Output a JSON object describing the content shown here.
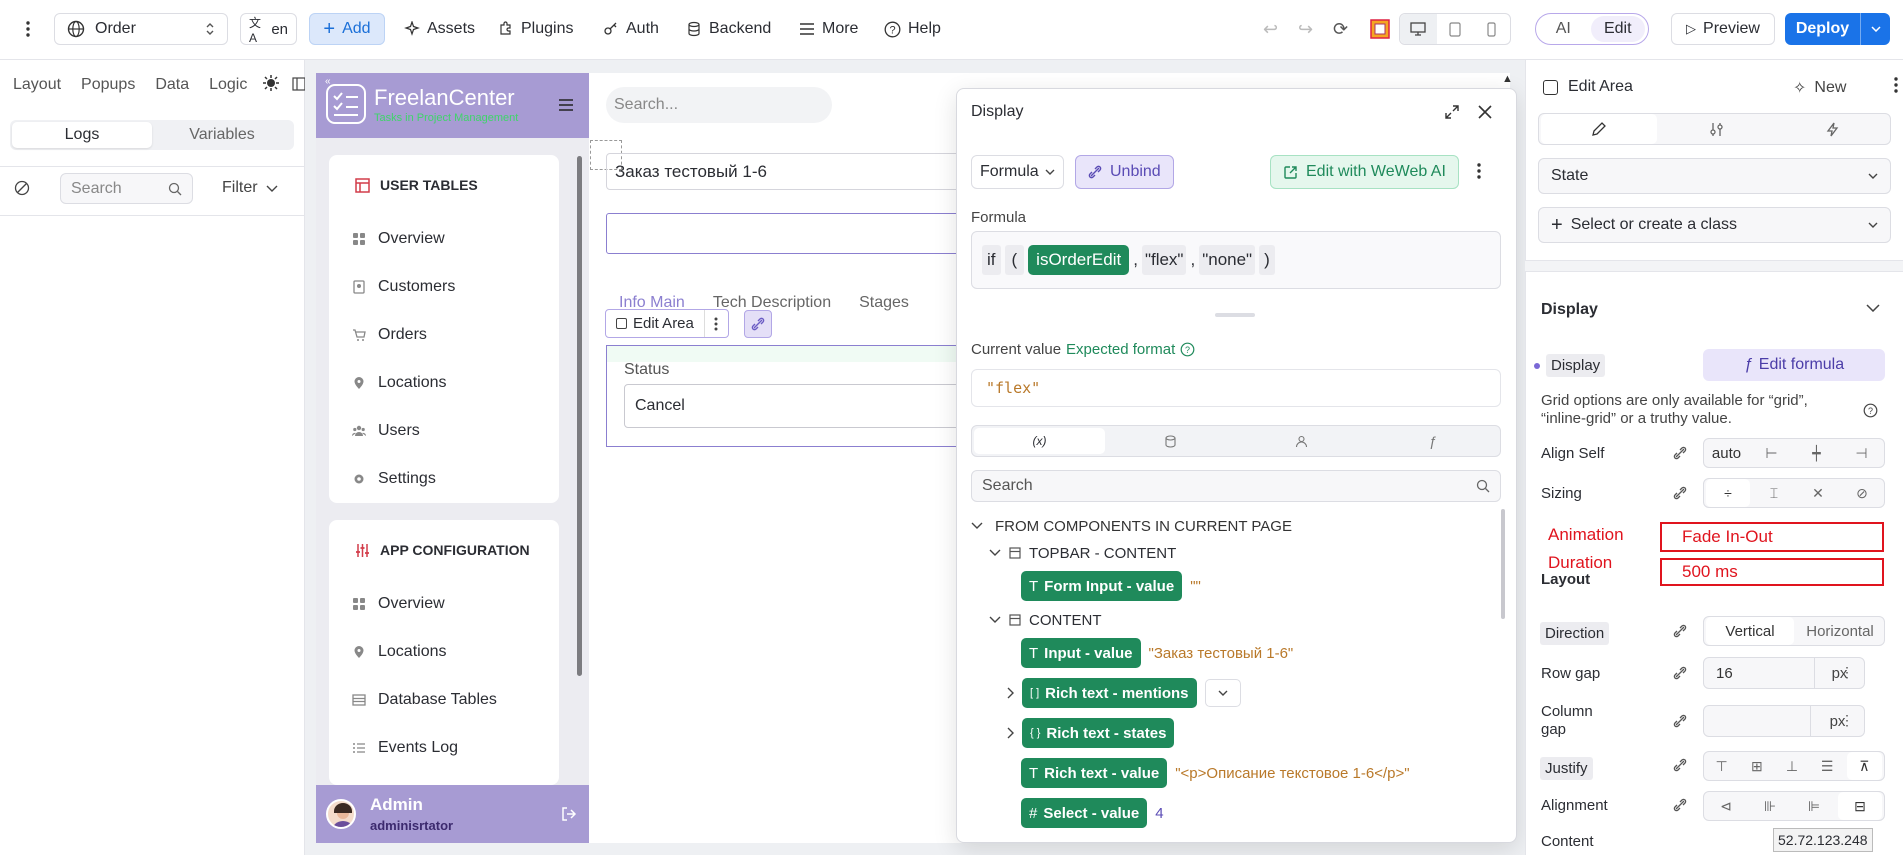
{
  "topbar": {
    "page_select": "Order",
    "lang": "en",
    "add": "Add",
    "assets": "Assets",
    "plugins": "Plugins",
    "auth": "Auth",
    "backend": "Backend",
    "more": "More",
    "help": "Help",
    "ai": "AI",
    "edit": "Edit",
    "preview": "Preview",
    "deploy": "Deploy"
  },
  "left_panel": {
    "tabs": [
      "Layout",
      "Popups",
      "Data",
      "Logic"
    ],
    "sub_tabs": [
      "Logs",
      "Variables"
    ],
    "search_placeholder": "Search",
    "filter": "Filter"
  },
  "app_sidebar": {
    "brand": "FreelanCenter",
    "brand_sub": "Tasks in Project Management",
    "section1_title": "USER TABLES",
    "section1_items": [
      "Overview",
      "Customers",
      "Orders",
      "Locations",
      "Users",
      "Settings"
    ],
    "section2_title": "APP CONFIGURATION",
    "section2_items": [
      "Overview",
      "Locations",
      "Database Tables",
      "Events Log"
    ],
    "user_name": "Admin",
    "user_role": "adminisrtator"
  },
  "app_main": {
    "search_placeholder": "Search...",
    "order_title": "Заказ тестовый 1-6",
    "tabs": [
      "Info Main",
      "Tech Description",
      "Stages"
    ],
    "edit_area_label": "Edit Area",
    "status_label": "Status",
    "status_value": "Cancel"
  },
  "modal": {
    "title": "Display",
    "formula_btn": "Formula",
    "unbind_btn": "Unbind",
    "ai_btn": "Edit with WeWeb AI",
    "formula_label": "Formula",
    "formula_if": "if",
    "formula_open": "(",
    "formula_var": "isOrderEdit",
    "formula_comma1": ",",
    "formula_arg1": "\"flex\"",
    "formula_comma2": ",",
    "formula_arg2": "\"none\"",
    "formula_close": ")",
    "current_value_label": "Current value",
    "expected_format": "Expected format",
    "current_value": "\"flex\"",
    "tab_vars": "(x)",
    "search_placeholder": "Search",
    "tree_root": "FROM COMPONENTS IN CURRENT PAGE",
    "group_topbar": "TOPBAR - CONTENT",
    "item_form_input": "Form Input - value",
    "item_form_input_val": "\"\"",
    "group_content": "CONTENT",
    "item_input": "Input - value",
    "item_input_val": "\"Заказ тестовый 1-6\"",
    "item_rt_mentions": "Rich text - mentions",
    "item_rt_states": "Rich text - states",
    "item_rt_value": "Rich text - value",
    "item_rt_value_val": "\"<p>Описание текстовое 1-6</p>\"",
    "item_select": "Select - value",
    "item_select_val": "4"
  },
  "right_panel": {
    "element_name": "Edit Area",
    "new_btn": "New",
    "state": "State",
    "class_select": "Select or create a class",
    "display_section": "Display",
    "display_prop": "Display",
    "edit_formula": "Edit formula",
    "grid_note": "Grid options are only available for “grid”, “inline-grid” or a truthy value.",
    "align_self": "Align Self",
    "align_self_value": "auto",
    "sizing": "Sizing",
    "layout_section": "Layout",
    "direction": "Direction",
    "direction_vertical": "Vertical",
    "direction_horizontal": "Horizontal",
    "row_gap": "Row gap",
    "row_gap_value": "16",
    "row_gap_unit": "px",
    "column_gap": "Column gap",
    "column_gap_unit": "px",
    "justify": "Justify",
    "alignment": "Alignment",
    "content": "Content",
    "ip_badge": "52.72.123.248"
  },
  "annotations": {
    "animation_label": "Animation",
    "animation_value": "Fade In-Out",
    "duration_label": "Duration",
    "duration_value": "500 ms"
  },
  "colors": {
    "accent_blue": "#1a73e8",
    "chip_green": "#1f8a5b",
    "sidebar_purple": "#a79bd3",
    "annotation_red": "#e0141e"
  }
}
